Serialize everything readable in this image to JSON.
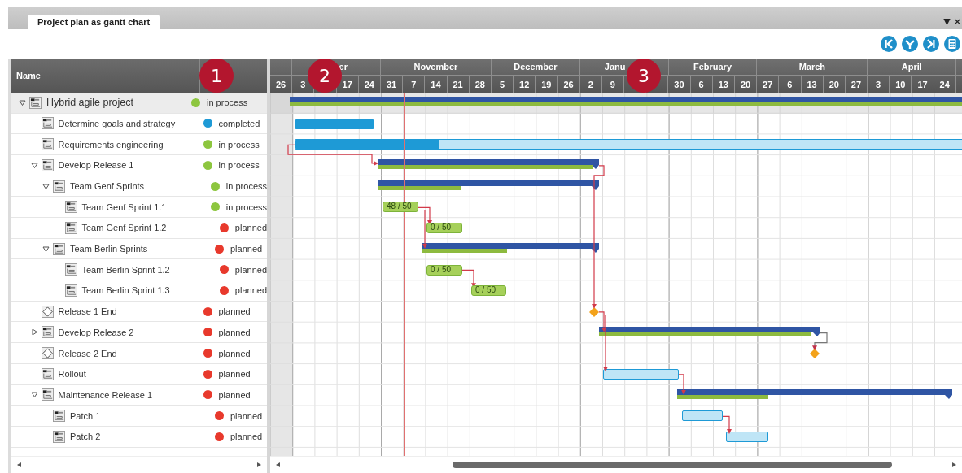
{
  "tab": {
    "label": "Project plan as gantt chart",
    "selected": true
  },
  "window_controls": [
    "▼",
    "×"
  ],
  "toolbar": [
    {
      "kind": "first"
    },
    {
      "kind": "down"
    },
    {
      "kind": "last"
    },
    {
      "kind": "calculator"
    }
  ],
  "table": {
    "columns": [
      "Name"
    ]
  },
  "callouts": [
    "1",
    "2",
    "3"
  ],
  "timeline": {
    "months": [
      {
        "weeks": [
          {
            "label": "26"
          }
        ]
      },
      {
        "label": "er",
        "weeks": [
          {
            "label": "3"
          },
          {
            "covered": true
          },
          {
            "label": "17"
          },
          {
            "label": "24"
          }
        ]
      },
      {
        "label": "November",
        "weeks": [
          {
            "label": "31"
          },
          {
            "label": "7"
          },
          {
            "label": "14"
          },
          {
            "label": "21"
          },
          {
            "label": "28"
          }
        ]
      },
      {
        "label": "December",
        "weeks": [
          {
            "label": "5"
          },
          {
            "label": "12"
          },
          {
            "label": "19"
          },
          {
            "label": "26"
          }
        ]
      },
      {
        "label": "Janu",
        "weeks": [
          {
            "label": "2"
          },
          {
            "label": "9"
          },
          {
            "covered": true
          },
          {
            "covered": true
          }
        ]
      },
      {
        "label": "February",
        "weeks": [
          {
            "label": "30"
          },
          {
            "label": "6"
          },
          {
            "label": "13"
          },
          {
            "label": "20"
          }
        ]
      },
      {
        "label": "March",
        "weeks": [
          {
            "label": "27"
          },
          {
            "label": "6"
          },
          {
            "label": "13"
          },
          {
            "label": "20"
          },
          {
            "label": "27"
          }
        ]
      },
      {
        "label": "April",
        "weeks": [
          {
            "label": "3"
          },
          {
            "label": "10"
          },
          {
            "label": "17"
          },
          {
            "label": "24"
          }
        ]
      }
    ]
  },
  "tasks": [
    {
      "kind": "task",
      "name": "Hybrid agile project",
      "status": "in process",
      "color": "#8dc63f",
      "selected": true,
      "expanded": true,
      "bar": {
        "kind": "summary",
        "level": 1
      },
      "children": [
        {
          "kind": "task",
          "name": "Determine goals and strategy",
          "status": "completed",
          "color": "#1e9ad6",
          "selected": false,
          "bar": {
            "kind": "task",
            "level": 1
          }
        },
        {
          "kind": "task",
          "name": "Requirements engineering",
          "status": "in process",
          "color": "#8dc63f",
          "selected": false,
          "bar": {
            "kind": "task",
            "level": 0.21
          }
        },
        {
          "kind": "task",
          "name": "Develop Release 1",
          "status": "in process",
          "color": "#8dc63f",
          "selected": false,
          "expanded": true,
          "bar": {
            "kind": "summary",
            "level": 0.97
          },
          "children": [
            {
              "kind": "task",
              "name": "Team Genf Sprints",
              "status": "in process",
              "color": "#8dc63f",
              "selected": false,
              "expanded": true,
              "bar": {
                "kind": "summary",
                "level": 0.38
              },
              "children": [
                {
                  "kind": "task",
                  "name": "Team Genf Sprint 1.1",
                  "status": "in process",
                  "color": "#8dc63f",
                  "selected": false,
                  "bar": {
                    "kind": "sprint",
                    "label": "48 / 50"
                  }
                },
                {
                  "kind": "task",
                  "name": "Team Genf Sprint 1.2",
                  "status": "planned",
                  "color": "#e8392c",
                  "selected": false,
                  "bar": {
                    "kind": "sprint",
                    "label": "0 / 50"
                  }
                }
              ]
            },
            {
              "kind": "task",
              "name": "Team Berlin Sprints",
              "status": "planned",
              "color": "#e8392c",
              "selected": false,
              "expanded": true,
              "bar": {
                "kind": "summary",
                "level": 0.48
              },
              "children": [
                {
                  "kind": "task",
                  "name": "Team Berlin Sprint 1.2",
                  "status": "planned",
                  "color": "#e8392c",
                  "selected": false,
                  "bar": {
                    "kind": "sprint",
                    "label": "0 / 50"
                  }
                },
                {
                  "kind": "task",
                  "name": "Team Berlin Sprint 1.3",
                  "status": "planned",
                  "color": "#e8392c",
                  "selected": false,
                  "bar": {
                    "kind": "sprint",
                    "label": "0 / 50"
                  }
                }
              ]
            }
          ]
        },
        {
          "kind": "milestone",
          "name": "Release 1 End",
          "status": "planned",
          "color": "#e8392c",
          "selected": false,
          "bar": {
            "kind": "milestone"
          }
        },
        {
          "kind": "task",
          "name": "Develop Release 2",
          "status": "planned",
          "color": "#e8392c",
          "selected": false,
          "expanded": false,
          "bar": {
            "kind": "summary",
            "level": 0.96
          }
        },
        {
          "kind": "milestone",
          "name": "Release 2 End",
          "status": "planned",
          "color": "#e8392c",
          "selected": false,
          "bar": {
            "kind": "milestone"
          }
        },
        {
          "kind": "task",
          "name": "Rollout",
          "status": "planned",
          "color": "#e8392c",
          "selected": false,
          "bar": {
            "kind": "task",
            "level": 0
          }
        },
        {
          "kind": "task",
          "name": "Maintenance Release 1",
          "status": "planned",
          "color": "#e8392c",
          "selected": false,
          "expanded": true,
          "bar": {
            "kind": "summary",
            "level": 0.33
          },
          "children": [
            {
              "kind": "task",
              "name": "Patch 1",
              "status": "planned",
              "color": "#e8392c",
              "selected": false,
              "bar": {
                "kind": "task",
                "level": 0
              }
            },
            {
              "kind": "task",
              "name": "Patch 2",
              "status": "planned",
              "color": "#e8392c",
              "selected": false,
              "bar": {
                "kind": "task",
                "level": 0
              }
            }
          ]
        }
      ]
    }
  ]
}
